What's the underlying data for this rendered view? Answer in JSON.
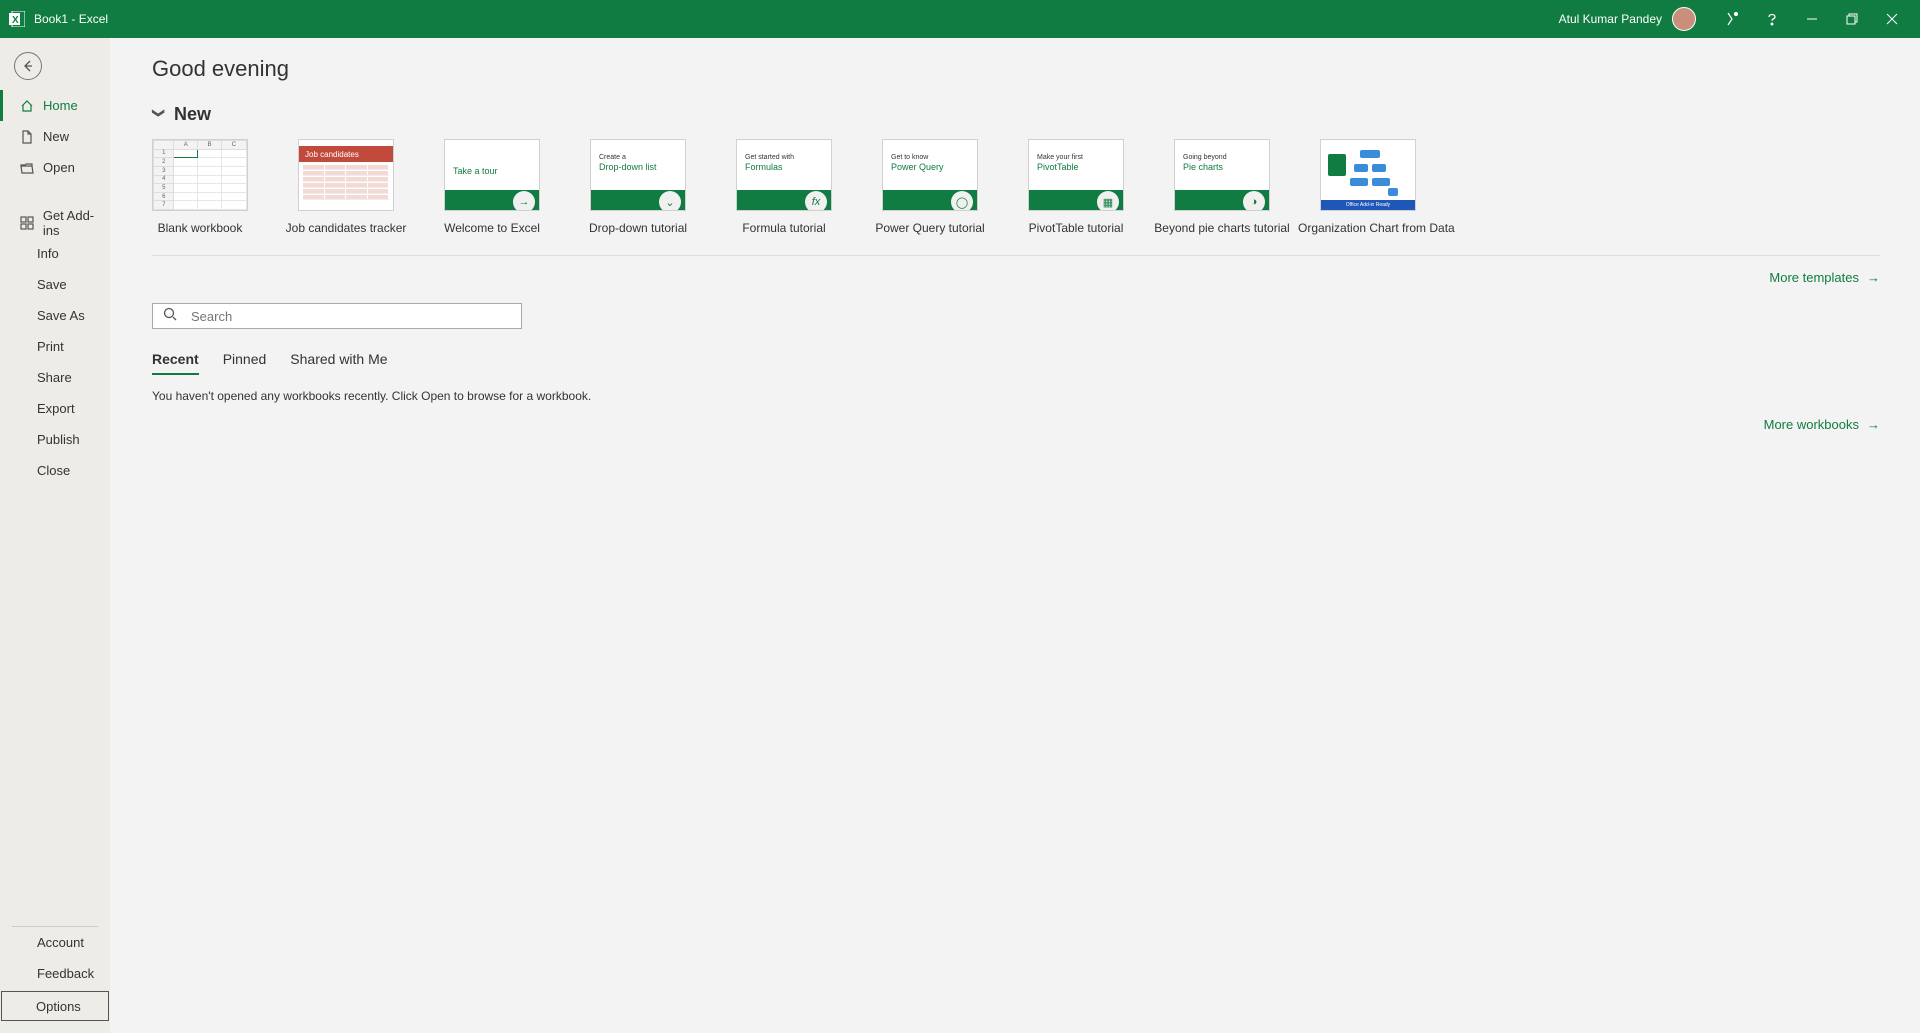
{
  "titlebar": {
    "title": "Book1  -  Excel",
    "user": "Atul Kumar Pandey"
  },
  "sidebar": {
    "home": "Home",
    "new": "New",
    "open": "Open",
    "addins": "Get Add-ins",
    "info": "Info",
    "save": "Save",
    "saveas": "Save As",
    "print": "Print",
    "share": "Share",
    "export": "Export",
    "publish": "Publish",
    "close": "Close",
    "account": "Account",
    "feedback": "Feedback",
    "options": "Options"
  },
  "main": {
    "greeting": "Good evening",
    "section_new": "New",
    "more_templates": "More templates",
    "more_workbooks": "More workbooks",
    "search_placeholder": "Search",
    "recent_msg": "You haven't opened any workbooks recently. Click Open to browse for a workbook.",
    "tabs": {
      "recent": "Recent",
      "pinned": "Pinned",
      "shared": "Shared with Me"
    },
    "templates": {
      "t0": {
        "label": "Blank workbook"
      },
      "t1": {
        "label": "Job candidates tracker",
        "thumb_title": "Job candidates"
      },
      "t2": {
        "label": "Welcome to Excel",
        "thumb_line": "Take a tour",
        "icon": "→"
      },
      "t3": {
        "label": "Drop-down tutorial",
        "thumb_top": "Create a",
        "thumb_title": "Drop-down list",
        "icon": "⌄"
      },
      "t4": {
        "label": "Formula tutorial",
        "thumb_top": "Get started with",
        "thumb_title": "Formulas",
        "icon": "fx"
      },
      "t5": {
        "label": "Power Query tutorial",
        "thumb_top": "Get to know",
        "thumb_title": "Power Query",
        "icon": "◯"
      },
      "t6": {
        "label": "PivotTable tutorial",
        "thumb_top": "Make your first",
        "thumb_title": "PivotTable",
        "icon": "▦"
      },
      "t7": {
        "label": "Beyond pie charts tutorial",
        "thumb_top": "Going beyond",
        "thumb_title": "Pie charts",
        "icon": "◑"
      },
      "t8": {
        "label": "Organization Chart from Data",
        "thumb_band": "Office Add-in Ready"
      }
    }
  }
}
